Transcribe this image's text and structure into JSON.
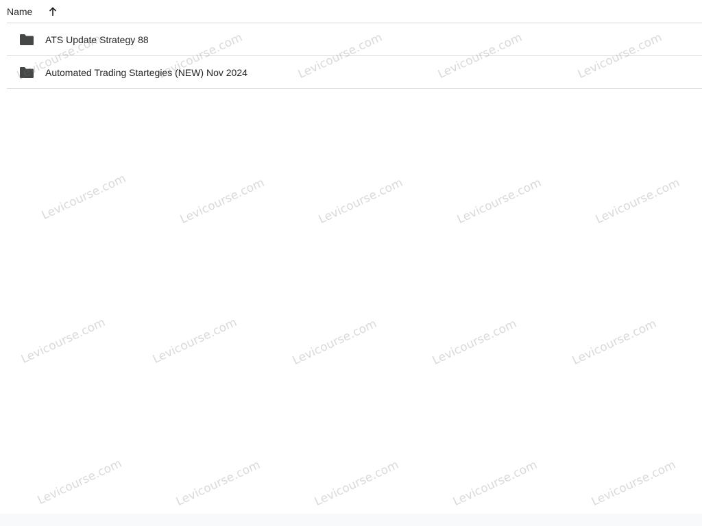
{
  "header": {
    "sort_label": "Name",
    "sort_icon": "arrow-up-icon"
  },
  "files": [
    {
      "icon": "folder-icon",
      "name": "ATS Update Strategy 88"
    },
    {
      "icon": "folder-icon",
      "name": "Automated Trading Startegies (NEW) Nov 2024"
    }
  ],
  "watermark": {
    "text": "Levicourse.com"
  },
  "colors": {
    "text": "#1f1f1f",
    "divider": "#d7d7d7",
    "icon": "#444746",
    "background": "#ffffff"
  }
}
